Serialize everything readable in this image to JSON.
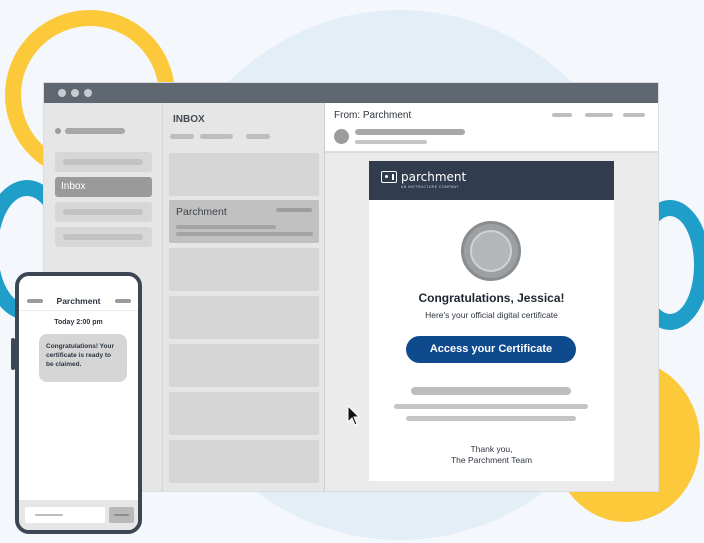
{
  "app": {
    "inbox_title": "INBOX",
    "sidebar": {
      "active_label": "Inbox"
    },
    "inbox_items": [
      {
        "sender": "Parchment",
        "selected": true
      }
    ],
    "reader": {
      "from": "From: Parchment"
    }
  },
  "email": {
    "brand": "parchment",
    "brand_sub": "AN INSTRUCTURE COMPANY",
    "greeting": "Congratulations, Jessica!",
    "subline": "Here's your official digital certificate",
    "cta_label": "Access your Certificate",
    "signoff_1": "Thank you,",
    "signoff_2": "The Parchment Team"
  },
  "phone": {
    "contact": "Parchment",
    "date": "Today 2:00 pm",
    "message": "Congratulations! Your certificate is ready to be claimed."
  },
  "colors": {
    "cta": "#0f4a8f",
    "card_header": "#313d4e",
    "accent_yellow": "#fbc93a",
    "accent_teal": "#1e9ec8"
  }
}
